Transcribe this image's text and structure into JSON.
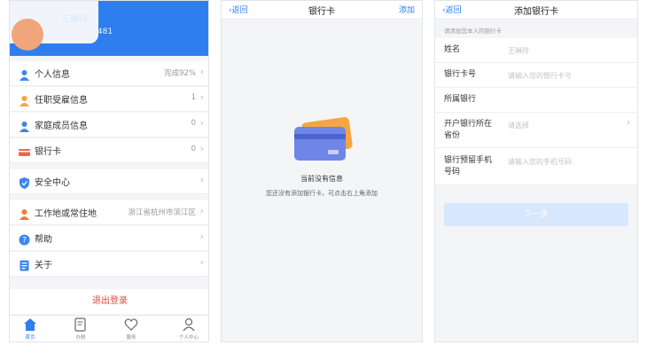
{
  "profile": {
    "name": "王琳玲",
    "phone": "153****7481",
    "rows": [
      {
        "label": "个人信息",
        "value": "完成92%",
        "icon": "person-icon",
        "color": "#3b86f0"
      },
      {
        "label": "任职受雇信息",
        "value": "1",
        "icon": "employment-icon",
        "color": "#f5a640"
      },
      {
        "label": "家庭成员信息",
        "value": "0",
        "icon": "family-icon",
        "color": "#3b86f0"
      },
      {
        "label": "银行卡",
        "value": "0",
        "icon": "bank-card-icon",
        "color": "#ef6350"
      },
      {
        "label": "安全中心",
        "value": "",
        "icon": "shield-icon",
        "color": "#3b86f0"
      },
      {
        "label": "工作地或常住地",
        "value": "浙江省杭州市滨江区",
        "icon": "location-person-icon",
        "color": "#f07a3b"
      },
      {
        "label": "帮助",
        "value": "",
        "icon": "help-icon",
        "color": "#3b86f0"
      },
      {
        "label": "关于",
        "value": "",
        "icon": "about-icon",
        "color": "#3b86f0"
      }
    ],
    "logout": "退出登录",
    "tabs": [
      "首页",
      "办税",
      "服务",
      "个人中心"
    ]
  },
  "bank_list": {
    "back": "返回",
    "title": "银行卡",
    "action": "添加",
    "empty_title": "当前没有信息",
    "empty_sub": "您还没有添加银行卡，可点击右上角添加"
  },
  "add_card": {
    "back": "返回",
    "title": "添加银行卡",
    "hint": "请添加您本人的银行卡",
    "fields": [
      {
        "label": "姓名",
        "value": "王琳玲"
      },
      {
        "label": "银行卡号",
        "value": "请输入您的银行卡号"
      },
      {
        "label": "所属银行",
        "value": ""
      },
      {
        "label": "开户银行所在省份",
        "value": "请选择"
      },
      {
        "label": "银行预留手机号码",
        "value": "请输入您的手机号码"
      }
    ],
    "next": "下一步"
  },
  "colors": {
    "accent": "#2f7ef0",
    "danger": "#e24a3a"
  }
}
